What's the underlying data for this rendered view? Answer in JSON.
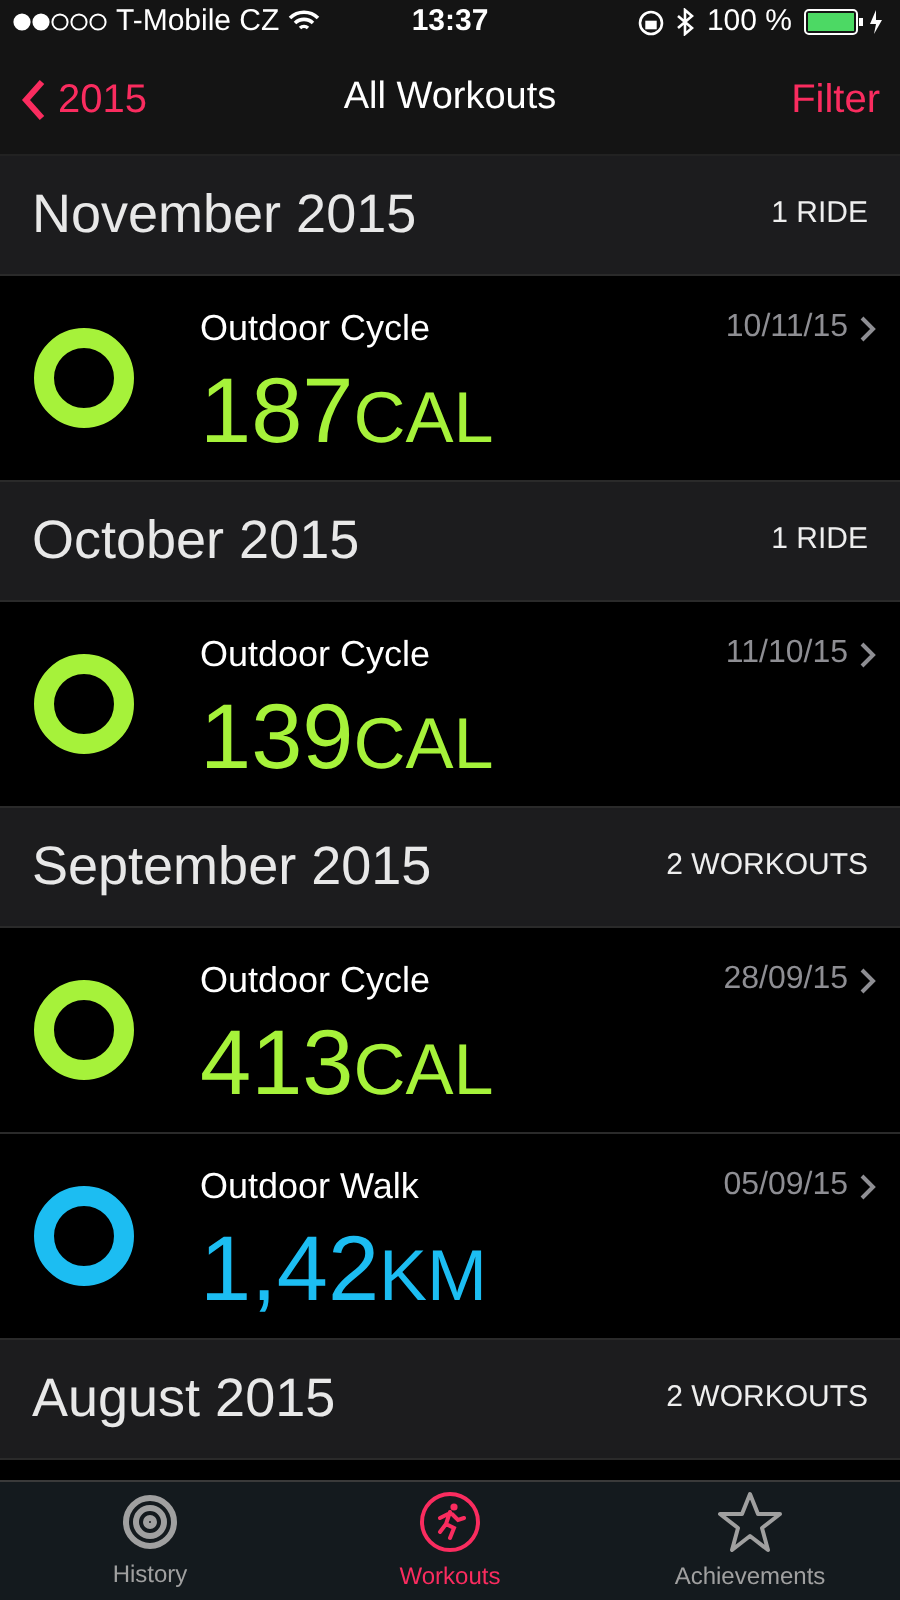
{
  "status_bar": {
    "carrier": "T-Mobile CZ",
    "time": "13:37",
    "battery": "100 %"
  },
  "nav": {
    "back": "2015",
    "title": "All Workouts",
    "action": "Filter"
  },
  "sections": [
    {
      "title": "November 2015",
      "count": "1 RIDE",
      "workouts": [
        {
          "name": "Outdoor Cycle",
          "date": "10/11/15",
          "value": "187",
          "unit": "CAL",
          "color": "#a6f23a"
        }
      ]
    },
    {
      "title": "October 2015",
      "count": "1 RIDE",
      "workouts": [
        {
          "name": "Outdoor Cycle",
          "date": "11/10/15",
          "value": "139",
          "unit": "CAL",
          "color": "#a6f23a"
        }
      ]
    },
    {
      "title": "September 2015",
      "count": "2 WORKOUTS",
      "workouts": [
        {
          "name": "Outdoor Cycle",
          "date": "28/09/15",
          "value": "413",
          "unit": "CAL",
          "color": "#a6f23a"
        },
        {
          "name": "Outdoor Walk",
          "date": "05/09/15",
          "value": "1,42",
          "unit": "KM",
          "color": "#1cbdf2"
        }
      ]
    },
    {
      "title": "August 2015",
      "count": "2 WORKOUTS"
    }
  ],
  "tabs": [
    {
      "label": "History",
      "kind": "history",
      "selected": false
    },
    {
      "label": "Workouts",
      "kind": "workouts",
      "selected": true
    },
    {
      "label": "Achievements",
      "kind": "achievements",
      "selected": false
    }
  ]
}
